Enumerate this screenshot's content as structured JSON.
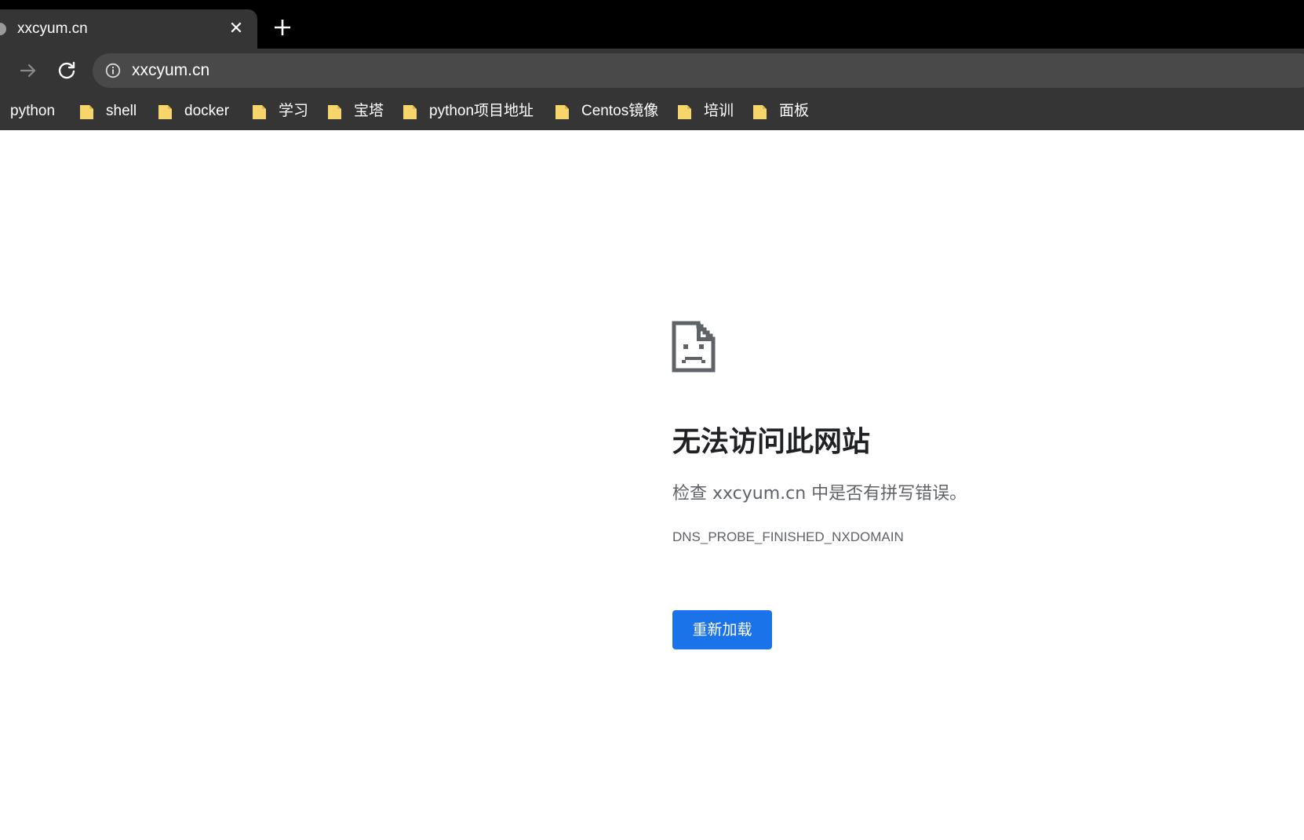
{
  "tab": {
    "title": "xxcyum.cn",
    "close_glyph": "✕",
    "favicon_icon": "globe-icon",
    "new_tab_icon": "plus-icon"
  },
  "toolbar": {
    "forward_icon": "arrow-right-icon",
    "reload_icon": "reload-icon",
    "site_info_icon": "info-icon",
    "url": "xxcyum.cn"
  },
  "bookmarks": [
    {
      "label": "python",
      "icon": ""
    },
    {
      "label": "shell",
      "icon": "folder-icon"
    },
    {
      "label": "docker",
      "icon": "folder-icon"
    },
    {
      "label": "学习",
      "icon": "folder-icon"
    },
    {
      "label": "宝塔",
      "icon": "folder-icon"
    },
    {
      "label": "python项目地址",
      "icon": "folder-icon"
    },
    {
      "label": "Centos镜像",
      "icon": "folder-icon"
    },
    {
      "label": "培训",
      "icon": "folder-icon"
    },
    {
      "label": "面板",
      "icon": "folder-icon"
    }
  ],
  "error": {
    "icon": "sad-page-icon",
    "title": "无法访问此网站",
    "detail": "检查 xxcyum.cn 中是否有拼写错误。",
    "code": "DNS_PROBE_FINISHED_NXDOMAIN",
    "reload_label": "重新加载"
  },
  "colors": {
    "tabstrip": "#000000",
    "chrome": "#353535",
    "omnibox": "#494949",
    "folder": "#f6d56a",
    "button": "#1a73e8"
  }
}
